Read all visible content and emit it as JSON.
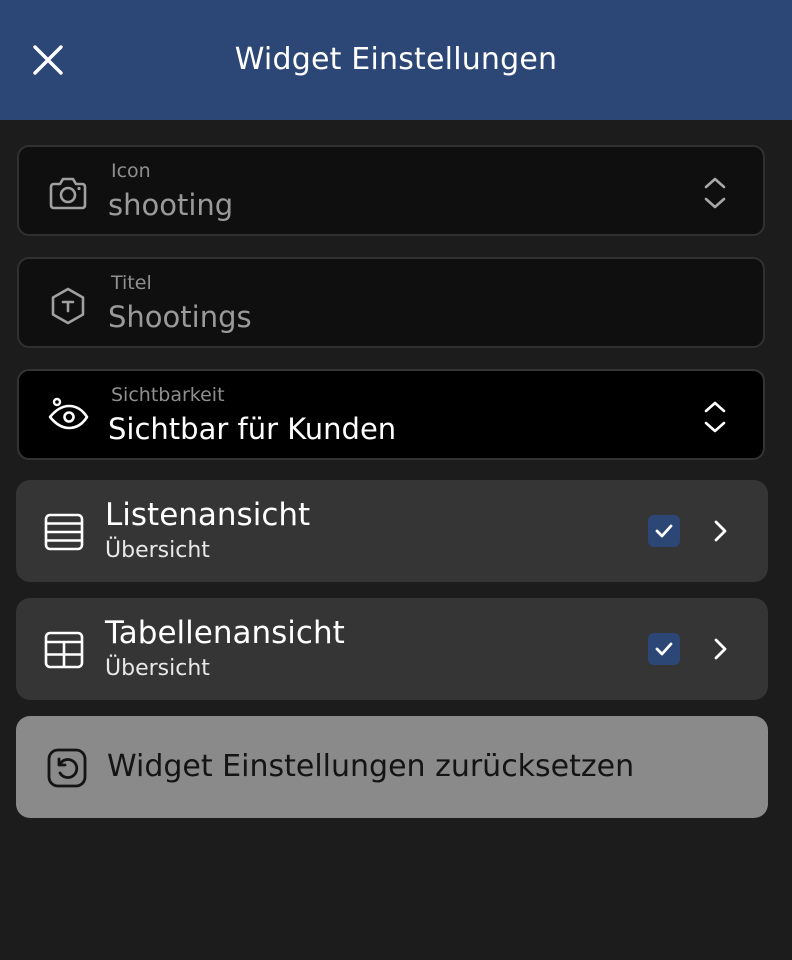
{
  "header": {
    "title": "Widget Einstellungen",
    "close_icon": "close-icon",
    "background": "#2c4676"
  },
  "fields": {
    "icon": {
      "label": "Icon",
      "value": "shooting",
      "icon": "camera-icon"
    },
    "title": {
      "label": "Titel",
      "value": "Shootings",
      "icon": "text-hexagon-icon"
    },
    "visibility": {
      "label": "Sichtbarkeit",
      "value": "Sichtbar für Kunden",
      "icon": "visibility-icon"
    }
  },
  "views": [
    {
      "title": "Listenansicht",
      "subtitle": "Übersicht",
      "checked": true,
      "icon": "list-view-icon"
    },
    {
      "title": "Tabellenansicht",
      "subtitle": "Übersicht",
      "checked": true,
      "icon": "table-view-icon"
    }
  ],
  "reset": {
    "label": "Widget Einstellungen zurücksetzen",
    "icon": "reset-icon"
  },
  "colors": {
    "accent": "#2c4676",
    "background": "#1c1c1c",
    "card": "#353535",
    "reset_button": "#8a8a8a"
  }
}
